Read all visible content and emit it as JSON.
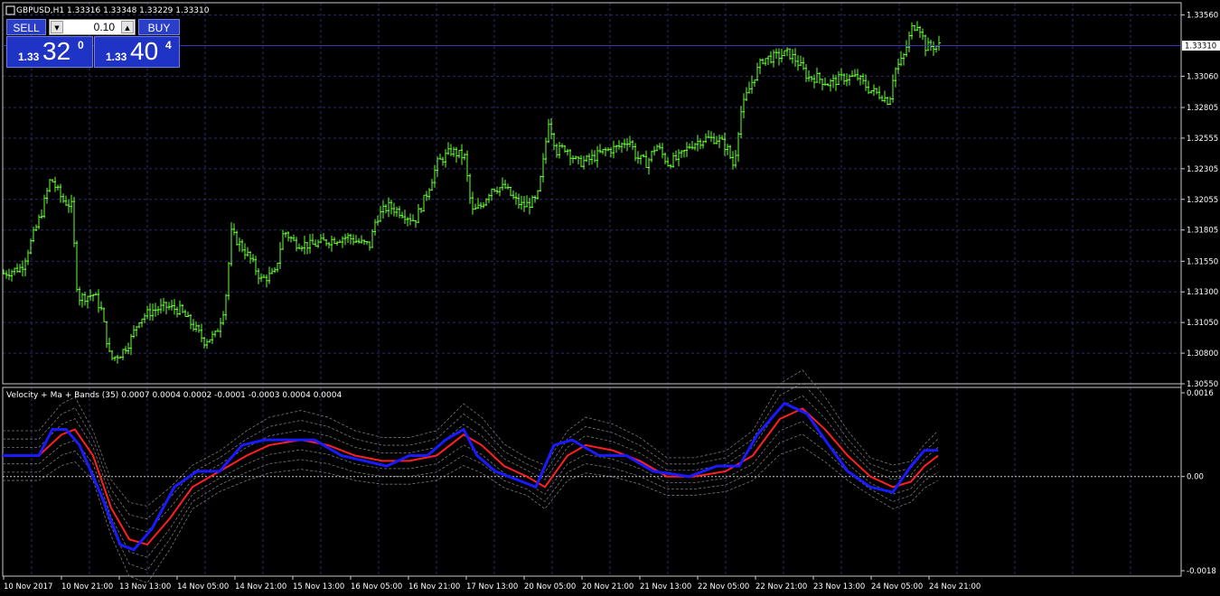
{
  "symbol_info": "GBPUSD,H1  1.33316 1.33348 1.33229 1.33310",
  "indicator_info": "Velocity + Ma + Bands (35) 0.0007 0.0004 0.0002 -0.0001 -0.0003 0.0004 0.0004",
  "trade_panel": {
    "sell_label": "SELL",
    "buy_label": "BUY",
    "lot_value": "0.10",
    "sell_price_prefix": "1.33",
    "sell_price_main": "32",
    "sell_price_sup": "0",
    "buy_price_prefix": "1.33",
    "buy_price_main": "40",
    "buy_price_sup": "4"
  },
  "colors": {
    "background": "#000000",
    "grid": "#2a2a6a",
    "candle": "#66ff33",
    "velocity": "#1a1aff",
    "ma": "#ff2020",
    "bands": "#777777"
  },
  "price_axis_labels": [
    "1.33560",
    "1.33310",
    "1.33060",
    "1.32805",
    "1.32555",
    "1.32305",
    "1.32055",
    "1.31805",
    "1.31550",
    "1.31300",
    "1.31050",
    "1.30800",
    "1.30550"
  ],
  "indicator_axis_labels": [
    "0.0016",
    "0.00",
    "-0.0018"
  ],
  "time_axis_labels": [
    "10 Nov 2017",
    "10 Nov 21:00",
    "13 Nov 13:00",
    "14 Nov 05:00",
    "14 Nov 21:00",
    "15 Nov 13:00",
    "16 Nov 05:00",
    "16 Nov 21:00",
    "17 Nov 13:00",
    "20 Nov 05:00",
    "20 Nov 21:00",
    "21 Nov 13:00",
    "22 Nov 05:00",
    "22 Nov 21:00",
    "23 Nov 13:00",
    "24 Nov 05:00",
    "24 Nov 21:00"
  ],
  "chart_data": [
    {
      "type": "candlestick",
      "series_name": "GBPUSD,H1",
      "ylim": [
        1.3055,
        1.3366
      ],
      "current_price": 1.3331,
      "close_path": [
        [
          0,
          1.3145
        ],
        [
          20,
          1.315
        ],
        [
          42,
          1.3195
        ],
        [
          52,
          1.3223
        ],
        [
          65,
          1.3205
        ],
        [
          75,
          1.32
        ],
        [
          82,
          1.3125
        ],
        [
          100,
          1.3128
        ],
        [
          108,
          1.3115
        ],
        [
          118,
          1.3075
        ],
        [
          130,
          1.308
        ],
        [
          140,
          1.309
        ],
        [
          150,
          1.3108
        ],
        [
          165,
          1.3115
        ],
        [
          180,
          1.3118
        ],
        [
          195,
          1.3115
        ],
        [
          212,
          1.31
        ],
        [
          222,
          1.309
        ],
        [
          235,
          1.3095
        ],
        [
          245,
          1.312
        ],
        [
          252,
          1.3178
        ],
        [
          262,
          1.3168
        ],
        [
          272,
          1.3158
        ],
        [
          285,
          1.314
        ],
        [
          300,
          1.3145
        ],
        [
          310,
          1.318
        ],
        [
          322,
          1.317
        ],
        [
          340,
          1.3168
        ],
        [
          360,
          1.3172
        ],
        [
          380,
          1.3175
        ],
        [
          395,
          1.317
        ],
        [
          405,
          1.3168
        ],
        [
          412,
          1.319
        ],
        [
          425,
          1.32
        ],
        [
          440,
          1.3195
        ],
        [
          455,
          1.3188
        ],
        [
          468,
          1.321
        ],
        [
          480,
          1.3235
        ],
        [
          495,
          1.3245
        ],
        [
          510,
          1.324
        ],
        [
          518,
          1.3195
        ],
        [
          528,
          1.32
        ],
        [
          540,
          1.3215
        ],
        [
          555,
          1.3215
        ],
        [
          565,
          1.3205
        ],
        [
          575,
          1.32
        ],
        [
          590,
          1.3205
        ],
        [
          596,
          1.323
        ],
        [
          603,
          1.327
        ],
        [
          612,
          1.3245
        ],
        [
          622,
          1.3248
        ],
        [
          635,
          1.3235
        ],
        [
          648,
          1.3238
        ],
        [
          665,
          1.3245
        ],
        [
          680,
          1.3248
        ],
        [
          692,
          1.3255
        ],
        [
          700,
          1.324
        ],
        [
          712,
          1.3235
        ],
        [
          722,
          1.325
        ],
        [
          735,
          1.3235
        ],
        [
          748,
          1.324
        ],
        [
          760,
          1.325
        ],
        [
          775,
          1.3255
        ],
        [
          790,
          1.3255
        ],
        [
          800,
          1.3248
        ],
        [
          808,
          1.3232
        ],
        [
          815,
          1.3275
        ],
        [
          822,
          1.329
        ],
        [
          830,
          1.3305
        ],
        [
          840,
          1.332
        ],
        [
          855,
          1.3322
        ],
        [
          868,
          1.3325
        ],
        [
          878,
          1.3318
        ],
        [
          890,
          1.3305
        ],
        [
          900,
          1.3305
        ],
        [
          912,
          1.33
        ],
        [
          930,
          1.3305
        ],
        [
          945,
          1.3305
        ],
        [
          958,
          1.3295
        ],
        [
          972,
          1.329
        ],
        [
          980,
          1.3285
        ],
        [
          985,
          1.331
        ],
        [
          995,
          1.332
        ],
        [
          1005,
          1.3345
        ],
        [
          1012,
          1.335
        ],
        [
          1020,
          1.333
        ],
        [
          1035,
          1.3331
        ]
      ]
    },
    {
      "type": "line",
      "series_name": "Velocity + Ma + Bands (35)",
      "ylim": [
        -0.0018,
        0.0016
      ],
      "series": [
        {
          "role": "velocity",
          "points": [
            [
              0,
              0.0004
            ],
            [
              40,
              0.0004
            ],
            [
              55,
              0.0009
            ],
            [
              70,
              0.0009
            ],
            [
              85,
              0.0006
            ],
            [
              110,
              -0.0004
            ],
            [
              130,
              -0.0013
            ],
            [
              145,
              -0.0014
            ],
            [
              165,
              -0.001
            ],
            [
              190,
              -0.0002
            ],
            [
              215,
              0.0001
            ],
            [
              240,
              0.0001
            ],
            [
              265,
              0.0006
            ],
            [
              290,
              0.0007
            ],
            [
              315,
              0.0007
            ],
            [
              345,
              0.0007
            ],
            [
              375,
              0.0004
            ],
            [
              400,
              0.0003
            ],
            [
              425,
              0.0002
            ],
            [
              450,
              0.0004
            ],
            [
              470,
              0.0004
            ],
            [
              490,
              0.0007
            ],
            [
              510,
              0.0009
            ],
            [
              525,
              0.0004
            ],
            [
              545,
              0.0001
            ],
            [
              575,
              -0.0001
            ],
            [
              590,
              -0.0002
            ],
            [
              610,
              0.0006
            ],
            [
              630,
              0.0007
            ],
            [
              660,
              0.0004
            ],
            [
              690,
              0.0004
            ],
            [
              720,
              0.0001
            ],
            [
              760,
              0.0
            ],
            [
              790,
              0.0002
            ],
            [
              815,
              0.0002
            ],
            [
              835,
              0.0008
            ],
            [
              865,
              0.0014
            ],
            [
              890,
              0.0012
            ],
            [
              910,
              0.0007
            ],
            [
              935,
              0.0001
            ],
            [
              960,
              -0.0002
            ],
            [
              985,
              -0.0003
            ],
            [
              1005,
              0.0002
            ],
            [
              1020,
              0.0005
            ],
            [
              1035,
              0.0005
            ]
          ]
        },
        {
          "role": "ma",
          "points": [
            [
              0,
              0.0004
            ],
            [
              40,
              0.0004
            ],
            [
              65,
              0.0008
            ],
            [
              80,
              0.0009
            ],
            [
              100,
              0.0004
            ],
            [
              120,
              -0.0006
            ],
            [
              140,
              -0.0012
            ],
            [
              160,
              -0.0013
            ],
            [
              185,
              -0.0008
            ],
            [
              210,
              -0.0002
            ],
            [
              240,
              0.0001
            ],
            [
              270,
              0.0004
            ],
            [
              295,
              0.0006
            ],
            [
              330,
              0.0007
            ],
            [
              360,
              0.0006
            ],
            [
              390,
              0.0004
            ],
            [
              420,
              0.0003
            ],
            [
              450,
              0.0003
            ],
            [
              480,
              0.0004
            ],
            [
              510,
              0.0008
            ],
            [
              530,
              0.0006
            ],
            [
              555,
              0.0002
            ],
            [
              580,
              0.0
            ],
            [
              600,
              -0.0002
            ],
            [
              625,
              0.0004
            ],
            [
              645,
              0.0006
            ],
            [
              675,
              0.0005
            ],
            [
              705,
              0.0003
            ],
            [
              735,
              0.0
            ],
            [
              765,
              0.0
            ],
            [
              800,
              0.0001
            ],
            [
              830,
              0.0004
            ],
            [
              860,
              0.0011
            ],
            [
              885,
              0.0013
            ],
            [
              910,
              0.0009
            ],
            [
              935,
              0.0004
            ],
            [
              960,
              0.0
            ],
            [
              985,
              -0.0002
            ],
            [
              1005,
              -0.0001
            ],
            [
              1020,
              0.0002
            ],
            [
              1035,
              0.0004
            ]
          ]
        }
      ]
    }
  ]
}
